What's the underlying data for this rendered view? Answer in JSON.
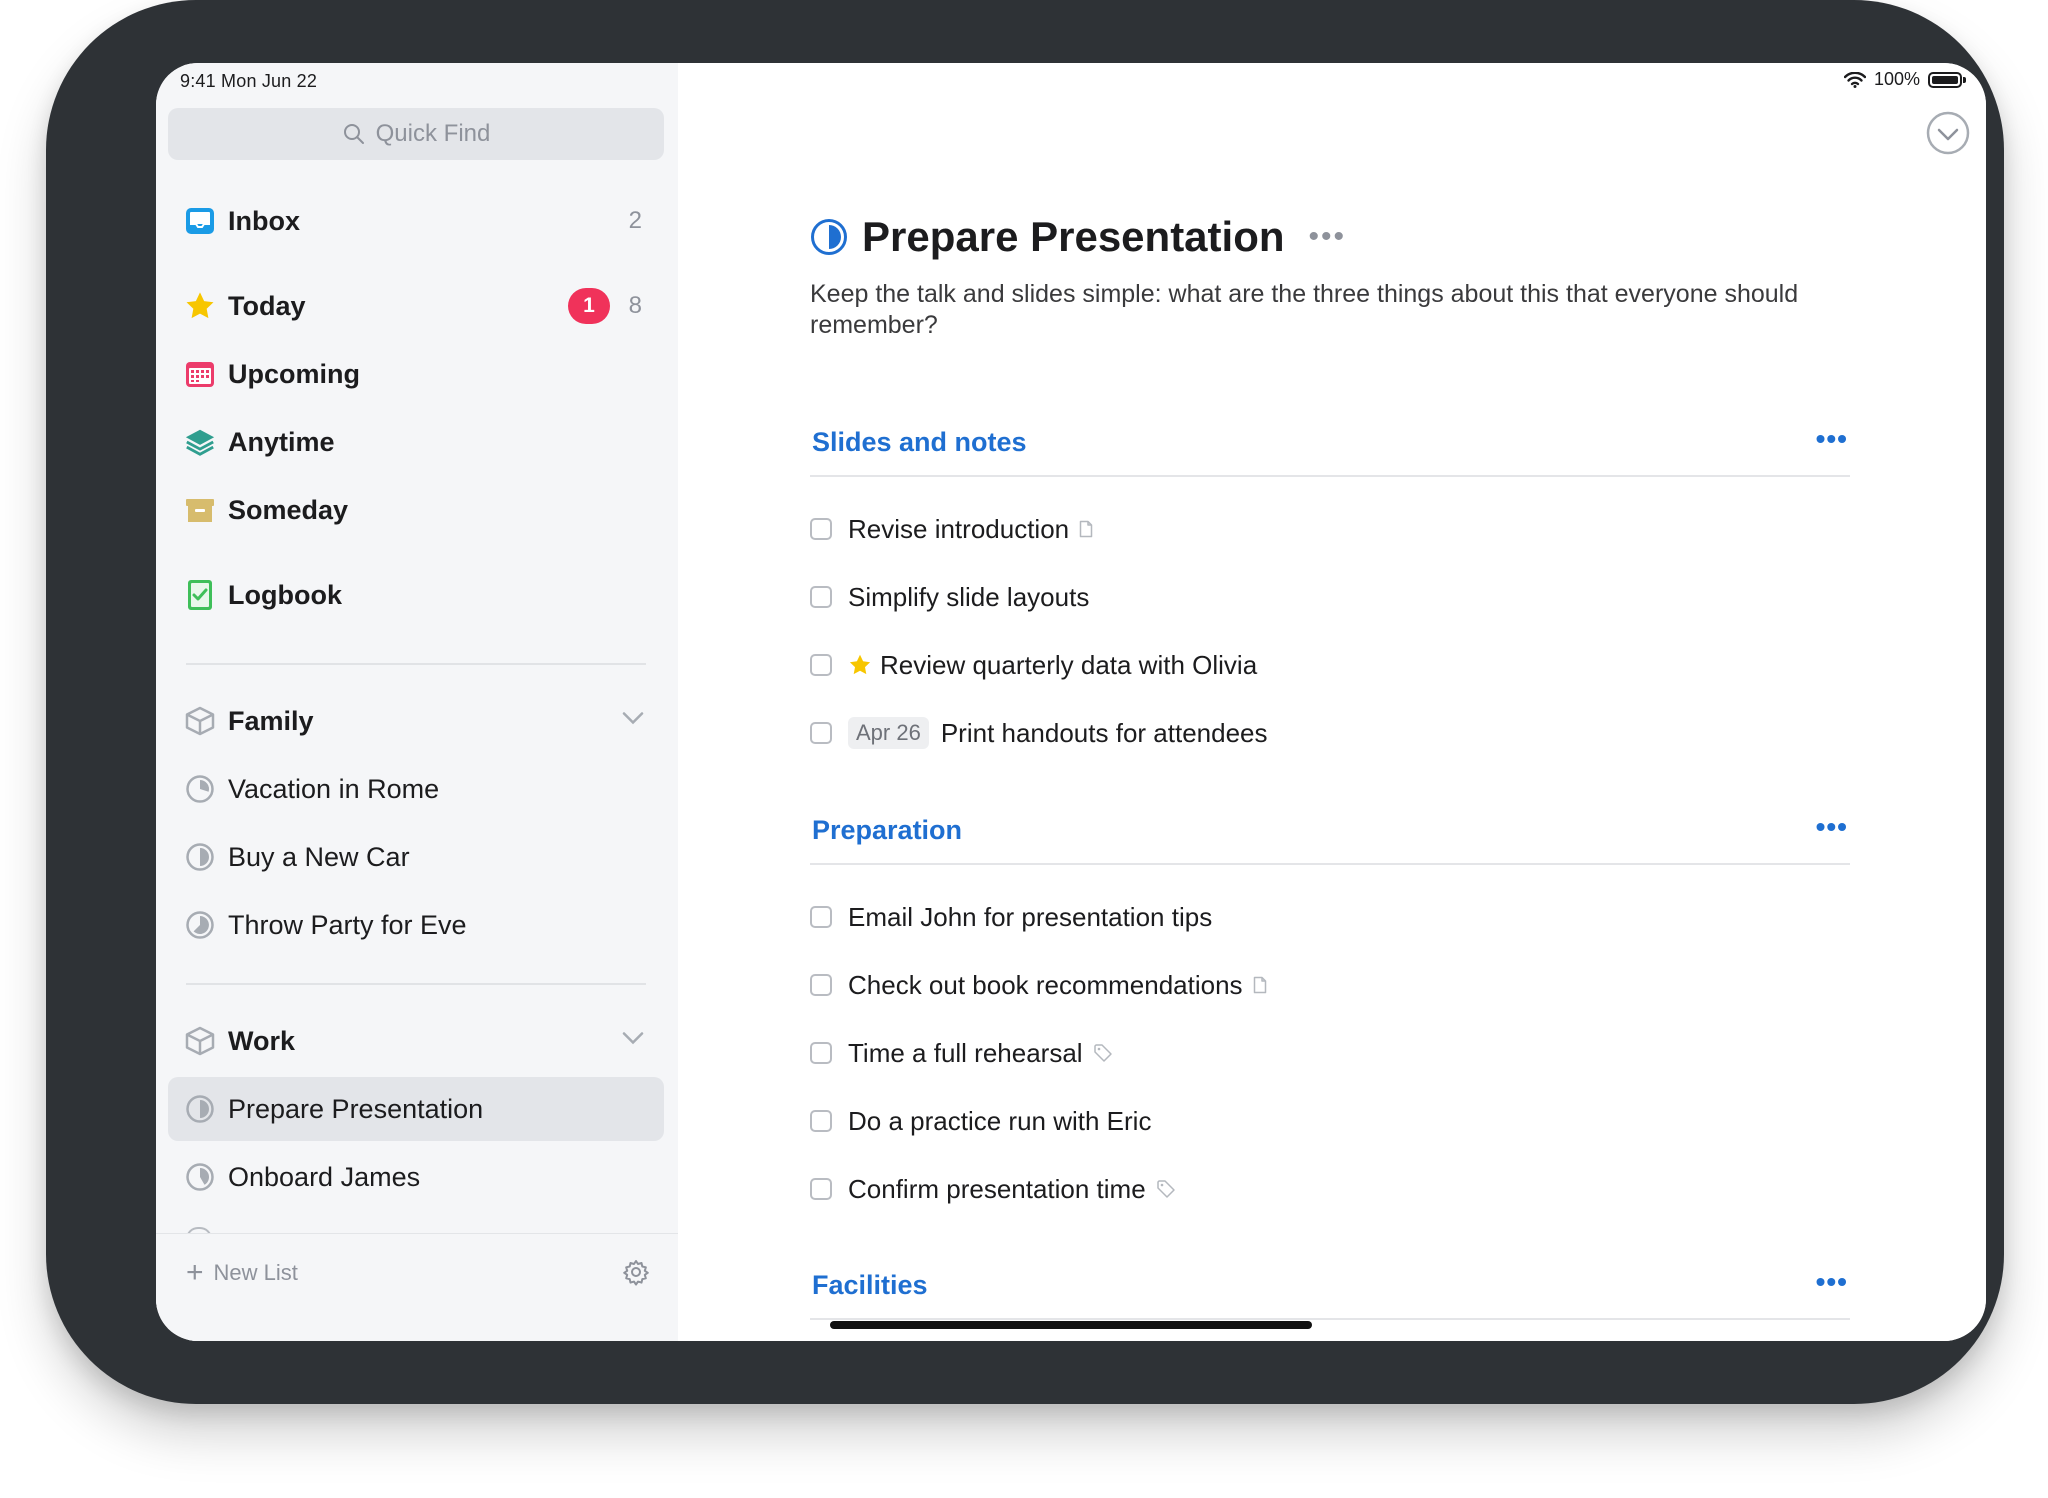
{
  "status": {
    "time": "9:41  Mon Jun 22",
    "battery": "100%"
  },
  "sidebar": {
    "search_placeholder": "Quick Find",
    "inbox": {
      "label": "Inbox",
      "count": "2"
    },
    "today": {
      "label": "Today",
      "badge": "1",
      "count": "8"
    },
    "upcoming": {
      "label": "Upcoming"
    },
    "anytime": {
      "label": "Anytime"
    },
    "someday": {
      "label": "Someday"
    },
    "logbook": {
      "label": "Logbook"
    },
    "areas": [
      {
        "label": "Family",
        "projects": [
          "Vacation in Rome",
          "Buy a New Car",
          "Throw Party for Eve"
        ]
      },
      {
        "label": "Work",
        "projects": [
          "Prepare Presentation",
          "Onboard James"
        ]
      }
    ],
    "new_list": "New List"
  },
  "project": {
    "title": "Prepare Presentation",
    "more": "•••",
    "notes": "Keep the talk and slides simple: what are the three things about this that everyone should remember?",
    "headings": [
      {
        "title": "Slides and notes",
        "more": "•••",
        "todos": [
          {
            "label": "Revise introduction",
            "note": true
          },
          {
            "label": "Simplify slide layouts"
          },
          {
            "label": "Review quarterly data with Olivia",
            "starred": true
          },
          {
            "label": "Print handouts for attendees",
            "date": "Apr 26"
          }
        ]
      },
      {
        "title": "Preparation",
        "more": "•••",
        "todos": [
          {
            "label": "Email John for presentation tips"
          },
          {
            "label": "Check out book recommendations",
            "note": true
          },
          {
            "label": "Time a full rehearsal",
            "tag": true
          },
          {
            "label": "Do a practice run with Eric"
          },
          {
            "label": "Confirm presentation time",
            "tag": true
          }
        ]
      },
      {
        "title": "Facilities",
        "more": "•••",
        "todos": []
      }
    ]
  },
  "colors": {
    "accent": "#1f6fd1",
    "badge": "#f0325a",
    "fab": "#3d8ef3",
    "star": "#f7c600"
  }
}
